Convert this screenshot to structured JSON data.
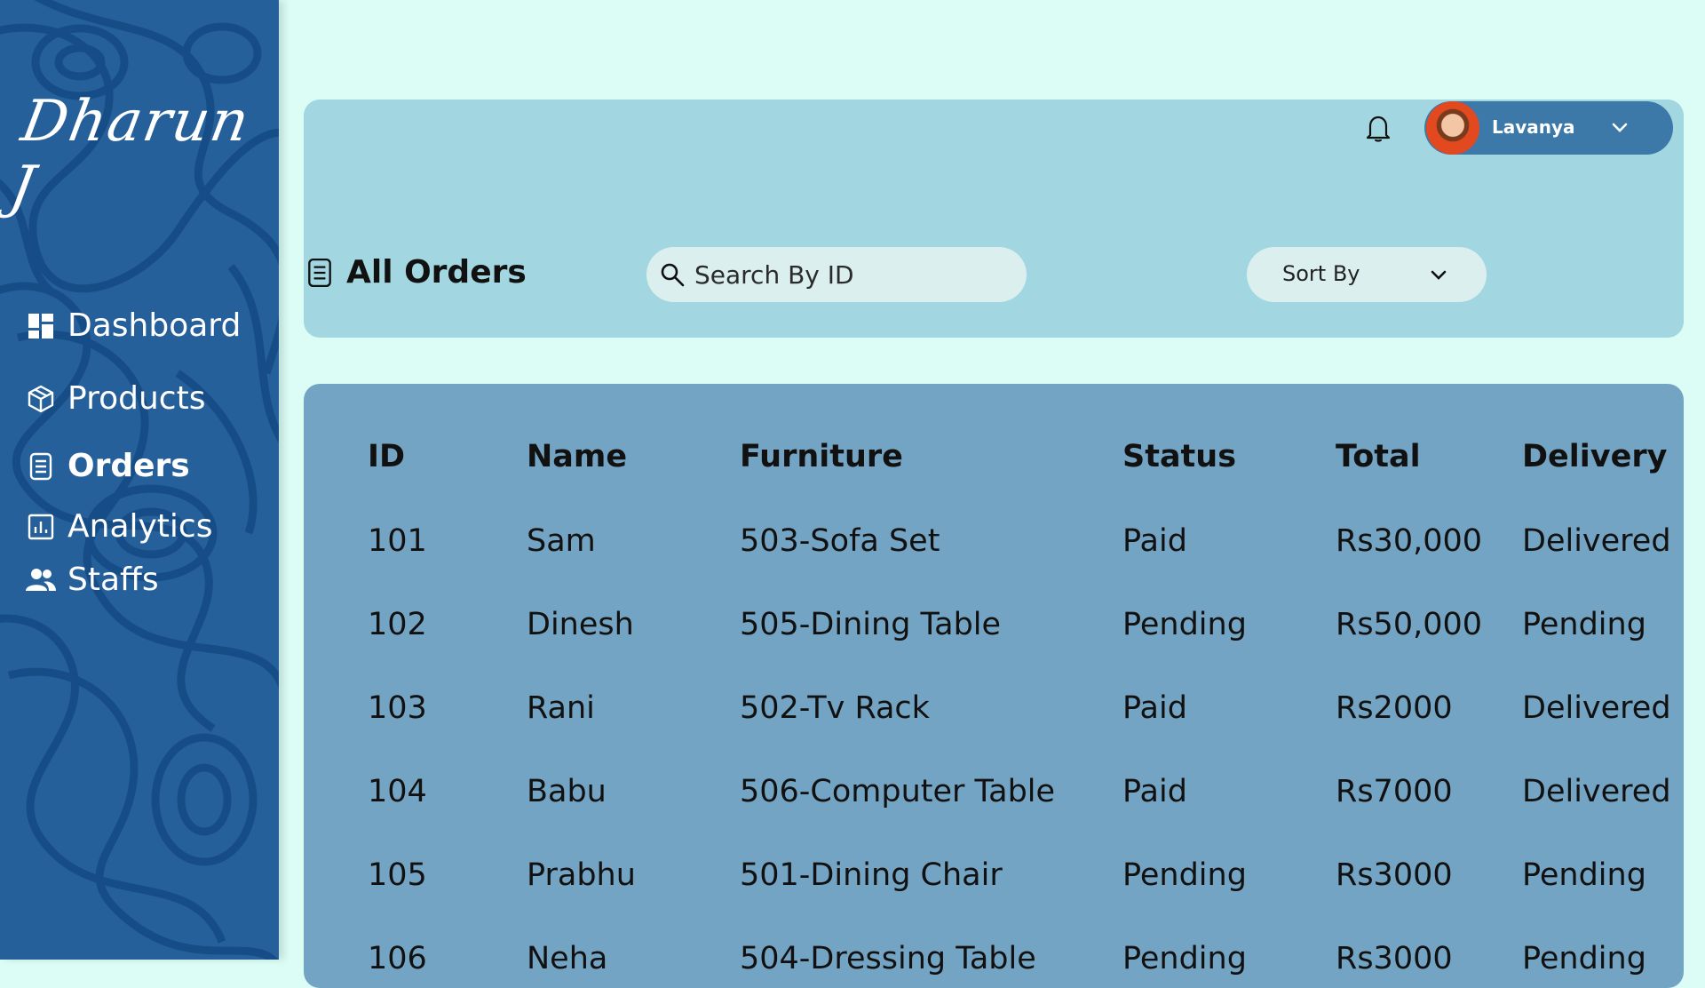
{
  "brand": {
    "logo_text": "Dharun J"
  },
  "sidebar": {
    "items": [
      {
        "label": "Dashboard",
        "icon": "dashboard-icon",
        "active": false
      },
      {
        "label": "Products",
        "icon": "box-icon",
        "active": false
      },
      {
        "label": "Orders",
        "icon": "document-icon",
        "active": true
      },
      {
        "label": "Analytics",
        "icon": "bar-chart-icon",
        "active": false
      },
      {
        "label": "Staffs",
        "icon": "people-icon",
        "active": false
      }
    ]
  },
  "header": {
    "user": {
      "name": "Lavanya"
    },
    "page_title": "All Orders",
    "search": {
      "placeholder": "Search By ID",
      "value": ""
    },
    "sort": {
      "label": "Sort By"
    }
  },
  "table": {
    "columns": [
      "ID",
      "Name",
      "Furniture",
      "Status",
      "Total",
      "Delivery"
    ],
    "rows": [
      [
        "101",
        "Sam",
        "503-Sofa Set",
        "Paid",
        "Rs30,000",
        "Delivered"
      ],
      [
        "102",
        "Dinesh",
        "505-Dining Table",
        "Pending",
        "Rs50,000",
        "Pending"
      ],
      [
        "103",
        "Rani",
        "502-Tv Rack",
        "Paid",
        "Rs2000",
        "Delivered"
      ],
      [
        "104",
        "Babu",
        "506-Computer Table",
        "Paid",
        "Rs7000",
        "Delivered"
      ],
      [
        "105",
        "Prabhu",
        "501-Dining Chair",
        "Pending",
        "Rs3000",
        "Pending"
      ],
      [
        "106",
        "Neha",
        "504-Dressing Table",
        "Pending",
        "Rs3000",
        "Pending"
      ]
    ]
  },
  "colors": {
    "page_bg": "#dcfdf6",
    "sidebar_bg": "#26609a",
    "header_card": "#a2d7e1",
    "table_card": "#74a4c3",
    "user_pill": "#3d79a8"
  }
}
